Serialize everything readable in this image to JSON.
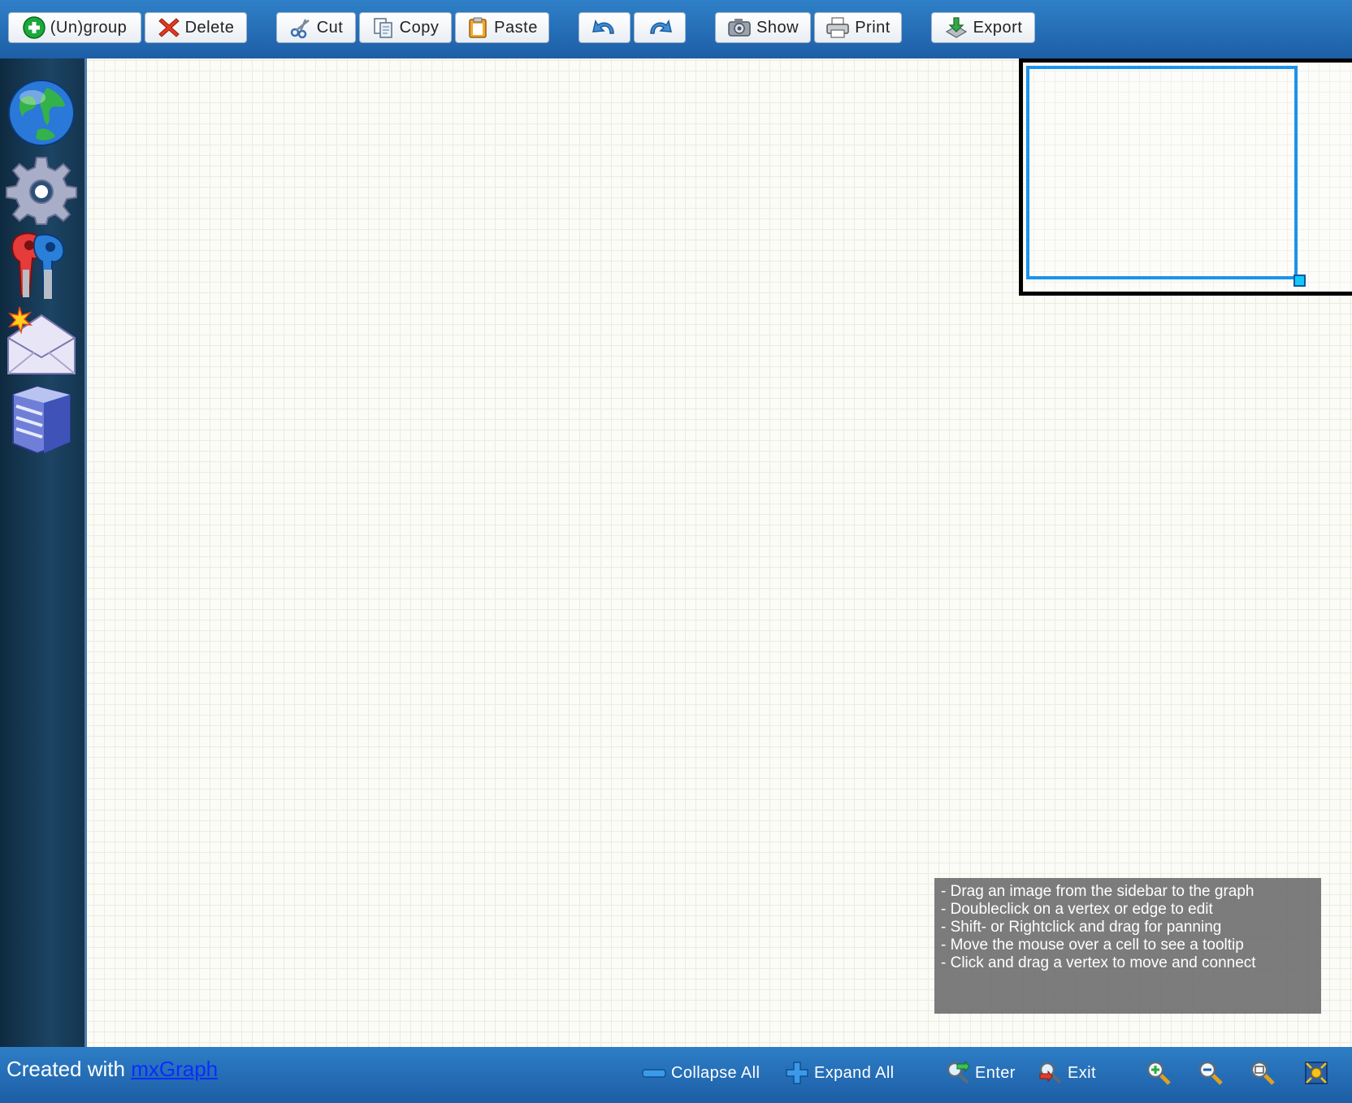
{
  "toolbar": {
    "group": "(Un)group",
    "delete": "Delete",
    "cut": "Cut",
    "copy": "Copy",
    "paste": "Paste",
    "undo_icon": "undo-icon",
    "redo_icon": "redo-icon",
    "show": "Show",
    "print": "Print",
    "export": "Export"
  },
  "sidebar": {
    "items": [
      "globe-icon",
      "gear-icon",
      "keys-icon",
      "mail-icon",
      "server-icon"
    ]
  },
  "instructions": [
    "- Drag an image from the sidebar to the graph",
    "- Doubleclick on a vertex or edge to edit",
    "- Shift- or Rightclick and drag for panning",
    "- Move the mouse over a cell to see a tooltip",
    "- Click and drag a vertex to move and connect"
  ],
  "footer": {
    "credit_prefix": "Created with",
    "credit_link": "mxGraph",
    "collapse_all": "Collapse All",
    "expand_all": "Expand All",
    "enter": "Enter",
    "exit": "Exit",
    "zoom_icons": [
      "zoom-in-icon",
      "zoom-out-icon",
      "zoom-actual-icon",
      "fit-icon"
    ]
  },
  "colors": {
    "toolbar": "#2f80c8",
    "sidebar": "#1c4463",
    "outline_view": "#1c93ee",
    "link": "#0b2cff"
  }
}
